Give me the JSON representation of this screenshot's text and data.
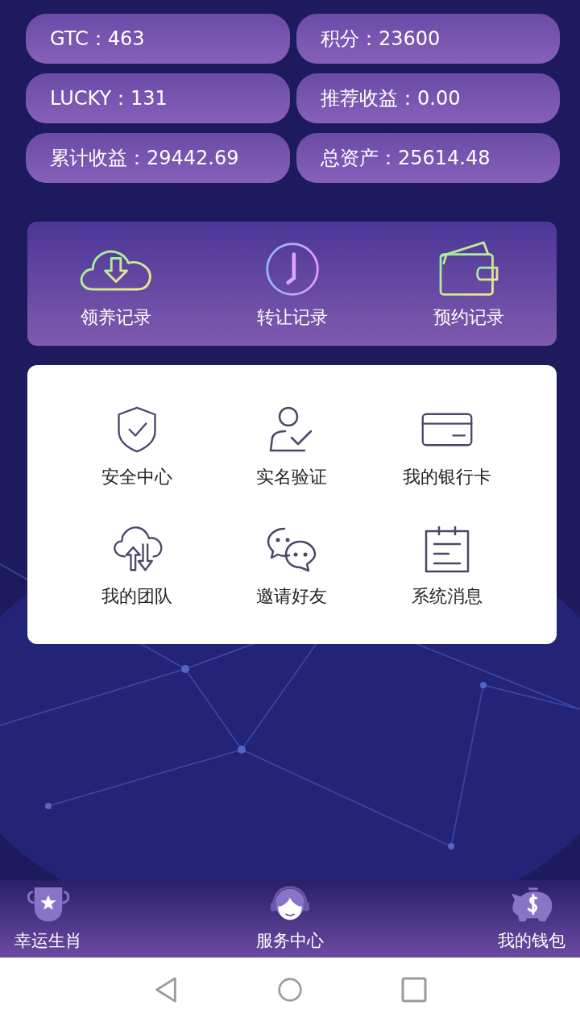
{
  "stats": [
    {
      "label": "GTC：",
      "value": "463"
    },
    {
      "label": "积分：",
      "value": "23600"
    },
    {
      "label": "LUCKY：",
      "value": "131"
    },
    {
      "label": "推荐收益：",
      "value": "0.00"
    },
    {
      "label": "累计收益：",
      "value": "29442.69"
    },
    {
      "label": "总资产：",
      "value": "25614.48"
    }
  ],
  "records": [
    {
      "label": "领养记录"
    },
    {
      "label": "转让记录"
    },
    {
      "label": "预约记录"
    }
  ],
  "menu": [
    {
      "label": "安全中心"
    },
    {
      "label": "实名验证"
    },
    {
      "label": "我的银行卡"
    },
    {
      "label": "我的团队"
    },
    {
      "label": "邀请好友"
    },
    {
      "label": "系统消息"
    }
  ],
  "tab_bar": [
    {
      "label": "幸运生肖"
    },
    {
      "label": "服务中心"
    },
    {
      "label": "我的钱包"
    }
  ]
}
